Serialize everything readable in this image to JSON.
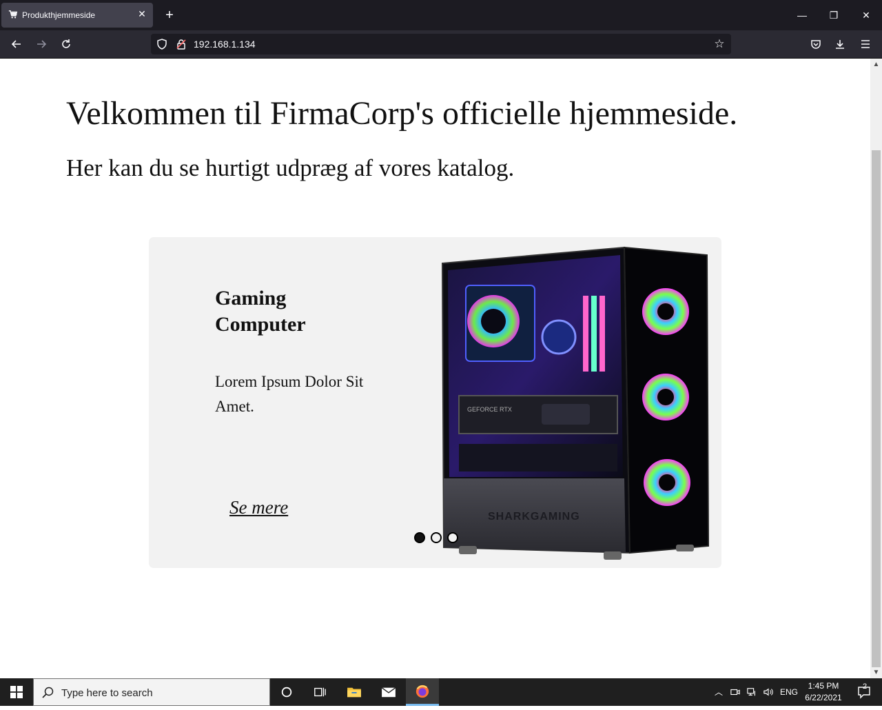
{
  "browser": {
    "tab_title": "Produkthjemmeside",
    "tab_close_icon": "close-icon",
    "new_tab_label": "+",
    "url": "192.168.1.134",
    "window_controls": {
      "minimize": "—",
      "restore": "❐",
      "close": "✕"
    }
  },
  "page": {
    "headline": "Velkommen til FirmaCorp's officielle hjemmeside.",
    "subheadline": "Her kan du se hurtigt udpræg af vores katalog.",
    "carousel": {
      "product_title": "Gaming Computer",
      "product_description": "Lorem Ipsum Dolor Sit Amet.",
      "see_more": "Se mere",
      "slide_count": 3,
      "active_slide": 1,
      "image": "gaming-pc-image",
      "image_text": {
        "gpu_label": "GEFORCE RTX",
        "brand": "SHARKGAMING"
      }
    }
  },
  "taskbar": {
    "search_placeholder": "Type here to search",
    "language": "ENG",
    "time": "1:45 PM",
    "date": "6/22/2021",
    "notifications": "2"
  },
  "colors": {
    "tab_bar": "#1c1b22",
    "nav_bar": "#2b2a33",
    "card_bg": "#f2f2f2",
    "taskbar": "#1f1f1f"
  }
}
